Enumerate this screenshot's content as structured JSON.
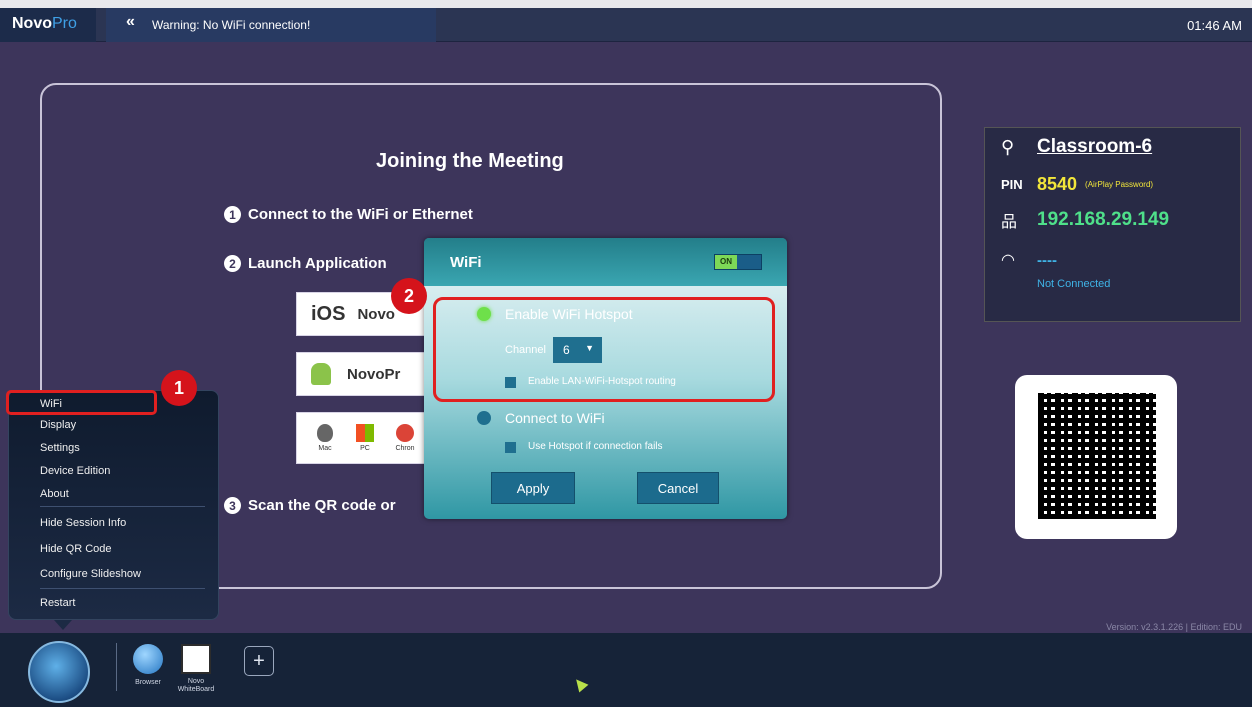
{
  "header": {
    "brand_main": "Novo",
    "brand_accent": "Pro",
    "warning": "Warning: No WiFi connection!",
    "clock": "01:46 AM"
  },
  "welcome": {
    "title": "Joining the Meeting",
    "step1_num": "1",
    "step1": "Connect to the WiFi  or  Ethernet",
    "step2_num": "2",
    "step2": "Launch Application",
    "step3_num": "3",
    "step3": "Scan the QR code or",
    "ios_label": "iOS",
    "ios_app": "Novo",
    "android_app": "NovoPr",
    "platforms": [
      "Mac",
      "PC",
      "Chron"
    ]
  },
  "info": {
    "room": "Classroom-6",
    "pin_label": "PIN",
    "pin": "8540",
    "pin_note": "(AirPlay Password)",
    "ip": "192.168.29.149",
    "wifi_value": "----",
    "wifi_status": "Not Connected"
  },
  "version": "Version:  v2.3.1.226 | Edition: EDU",
  "menu": {
    "items": [
      "WiFi",
      "Display",
      "Settings",
      "Device Edition",
      "About",
      "Hide Session Info",
      "Hide QR Code",
      "Configure Slideshow",
      "Restart"
    ]
  },
  "dialog": {
    "title": "WiFi",
    "toggle": "ON",
    "hotspot_label": "Enable WiFi Hotspot",
    "channel_label": "Channel",
    "channel_value": "6",
    "routing_label": "Enable LAN-WiFi-Hotspot routing",
    "connect_label": "Connect to WiFi",
    "fallback_label": "Use Hotspot if connection fails",
    "apply": "Apply",
    "cancel": "Cancel"
  },
  "badges": [
    "1",
    "2"
  ],
  "taskbar": {
    "browser": "Browser",
    "whiteboard_line1": "Novo",
    "whiteboard_line2": "WhiteBoard",
    "add": "+"
  },
  "colors": {
    "background": "#3d355b",
    "highlight": "#e02020",
    "pin": "#f2e63a",
    "ip": "#4fe08a",
    "wifi": "#3fb3e6"
  }
}
